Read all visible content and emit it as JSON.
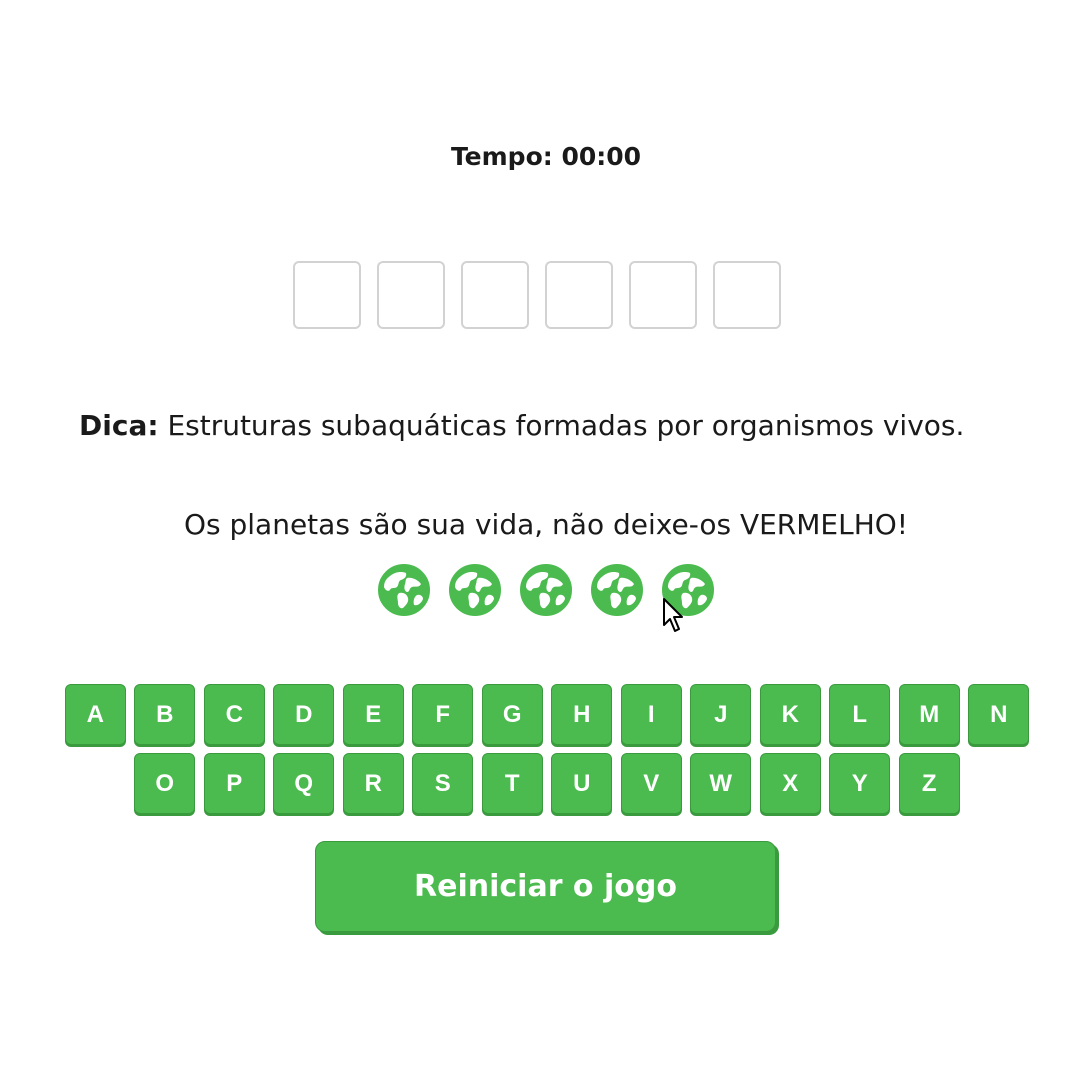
{
  "timer": {
    "label": "Tempo:",
    "value": "00:00"
  },
  "word": {
    "slots": [
      "",
      "",
      "",
      "",
      "",
      ""
    ]
  },
  "hint": {
    "label": "Dica:",
    "text": "Estruturas subaquáticas formadas por organismos vivos."
  },
  "warning": "Os planetas são sua vida, não deixe-os VERMELHO!",
  "lives": {
    "count": 5,
    "icon": "globe-icon",
    "color": "#4bbb4f"
  },
  "keyboard": {
    "row1": [
      "A",
      "B",
      "C",
      "D",
      "E",
      "F",
      "G",
      "H",
      "I",
      "J",
      "K",
      "L",
      "M",
      "N"
    ],
    "row2": [
      "O",
      "P",
      "Q",
      "R",
      "S",
      "T",
      "U",
      "V",
      "W",
      "X",
      "Y",
      "Z"
    ]
  },
  "restart_label": "Reiniciar o jogo",
  "colors": {
    "accent": "#4bbb4f",
    "accent_dark": "#3a9a3e"
  }
}
